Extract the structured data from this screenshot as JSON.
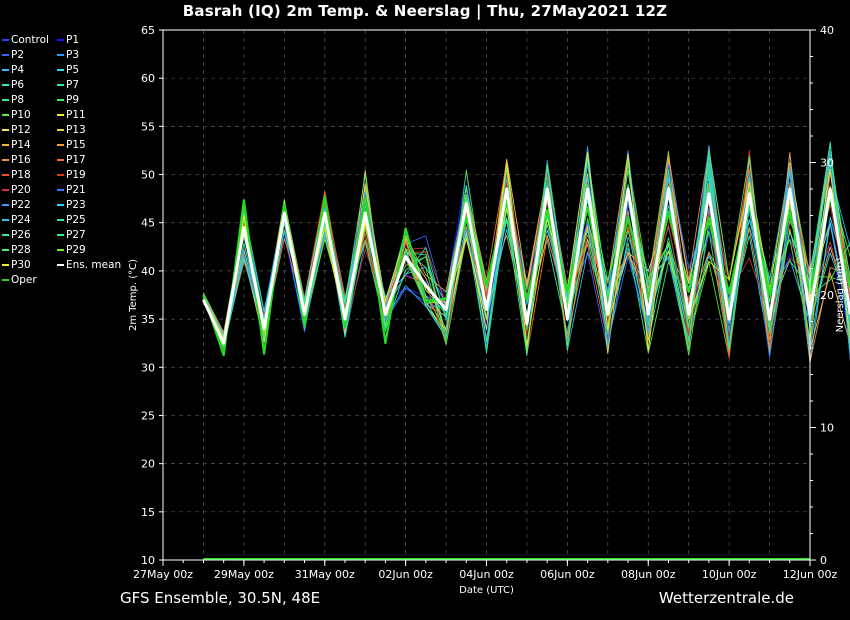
{
  "title": "Basrah  (IQ)  2m Temp. & Neerslag | Thu, 27May2021 12Z",
  "footer_left": "GFS Ensemble, 30.5N, 48E",
  "footer_right": "Wetterzentrale.de",
  "colors": {
    "background": "#000000",
    "ens_mean": "#ffffff",
    "oper": "#22dd22"
  },
  "legend": [
    {
      "name": "Control",
      "color": "#2b3cff"
    },
    {
      "name": "P1",
      "color": "#1a1aff"
    },
    {
      "name": "P2",
      "color": "#2f6bff"
    },
    {
      "name": "P3",
      "color": "#2a9bff"
    },
    {
      "name": "P4",
      "color": "#33b8ff"
    },
    {
      "name": "P5",
      "color": "#33d8e8"
    },
    {
      "name": "P6",
      "color": "#33e8c8"
    },
    {
      "name": "P7",
      "color": "#33e8a8"
    },
    {
      "name": "P8",
      "color": "#33e888"
    },
    {
      "name": "P9",
      "color": "#44ee66"
    },
    {
      "name": "P10",
      "color": "#55ee33"
    },
    {
      "name": "P11",
      "color": "#eeee33"
    },
    {
      "name": "P12",
      "color": "#f4e070"
    },
    {
      "name": "P13",
      "color": "#f4c860"
    },
    {
      "name": "P14",
      "color": "#f4b040"
    },
    {
      "name": "P15",
      "color": "#f4a030"
    },
    {
      "name": "P16",
      "color": "#f49050"
    },
    {
      "name": "P17",
      "color": "#f47030"
    },
    {
      "name": "P18",
      "color": "#f05020"
    },
    {
      "name": "P19",
      "color": "#d84010"
    },
    {
      "name": "P20",
      "color": "#cc3030"
    },
    {
      "name": "P21",
      "color": "#2b7cff"
    },
    {
      "name": "P22",
      "color": "#3399ff"
    },
    {
      "name": "P23",
      "color": "#33ccff"
    },
    {
      "name": "P24",
      "color": "#33c0f0"
    },
    {
      "name": "P25",
      "color": "#33e8b8"
    },
    {
      "name": "P26",
      "color": "#33e898"
    },
    {
      "name": "P27",
      "color": "#33ee88"
    },
    {
      "name": "P28",
      "color": "#44ee66"
    },
    {
      "name": "P29",
      "color": "#66ee33"
    },
    {
      "name": "P30",
      "color": "#eeee22"
    },
    {
      "name": "Ens. mean",
      "color": "#ffffff"
    },
    {
      "name": "Oper",
      "color": "#22dd22"
    }
  ],
  "chart_data": {
    "type": "line",
    "ylabel": "2m Temp. (°C)",
    "y2label": "Neerslag (mm)",
    "xlabel": "Date (UTC)",
    "ylim": [
      10,
      65
    ],
    "y2lim": [
      0,
      40
    ],
    "yticks": [
      10,
      15,
      20,
      25,
      30,
      35,
      40,
      45,
      50,
      55,
      60,
      65
    ],
    "y2ticks": [
      0,
      10,
      20,
      30,
      40
    ],
    "x_tick_labels": [
      "27May 00z",
      "29May 00z",
      "31May 00z",
      "02Jun 00z",
      "04Jun 00z",
      "06Jun 00z",
      "08Jun 00z",
      "10Jun 00z",
      "12Jun 00z"
    ],
    "x_hours": [
      -12,
      36,
      84,
      132,
      180,
      228,
      276,
      324,
      372
    ],
    "xlim_hours": [
      -12,
      372
    ],
    "grid": true,
    "timestep_hours": 12,
    "ens_mean_2m_temp": [
      37.0,
      32.5,
      44.5,
      34.0,
      46.0,
      35.5,
      46.0,
      35.0,
      46.0,
      35.5,
      41.5,
      38.5,
      36.0,
      47.0,
      36.0,
      48.5,
      34.5,
      48.5,
      35.0,
      48.5,
      35.5,
      48.5,
      35.5,
      48.5,
      35.5,
      48.0,
      35.0,
      48.0,
      35.0,
      48.5,
      35.5,
      48.5,
      35.5
    ],
    "spread_low": [
      36.5,
      31.8,
      40.5,
      32.5,
      43.0,
      33.5,
      43.0,
      33.0,
      42.0,
      33.5,
      38.0,
      36.0,
      32.0,
      43.0,
      31.0,
      42.0,
      31.0,
      42.0,
      30.8,
      41.0,
      30.5,
      41.0,
      31.0,
      40.0,
      31.0,
      40.0,
      30.5,
      41.0,
      30.5,
      40.0,
      30.2,
      38.0,
      30.0
    ],
    "spread_high": [
      37.8,
      33.8,
      46.5,
      36.0,
      47.5,
      37.5,
      48.5,
      37.5,
      50.8,
      37.5,
      44.5,
      44.0,
      38.0,
      51.2,
      39.5,
      52.2,
      39.0,
      51.8,
      38.5,
      53.3,
      40.0,
      53.0,
      40.5,
      52.8,
      40.5,
      53.3,
      39.5,
      53.0,
      39.5,
      52.8,
      40.5,
      53.8,
      43.5
    ],
    "precip_mm_all_members": 0
  }
}
